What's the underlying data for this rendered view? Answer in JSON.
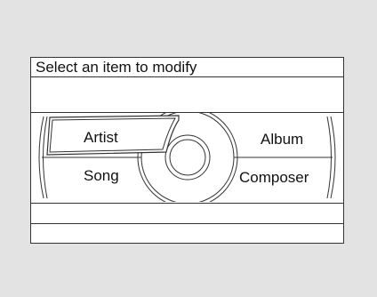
{
  "screen": {
    "prompt": "Select an item to modify"
  },
  "menu": {
    "items": [
      {
        "id": "artist",
        "label": "Artist",
        "selected": true
      },
      {
        "id": "album",
        "label": "Album",
        "selected": false
      },
      {
        "id": "song",
        "label": "Song",
        "selected": false
      },
      {
        "id": "composer",
        "label": "Composer",
        "selected": false
      }
    ]
  },
  "colors": {
    "background": "#e3e3e3",
    "panel": "#ffffff",
    "line": "#333333"
  }
}
